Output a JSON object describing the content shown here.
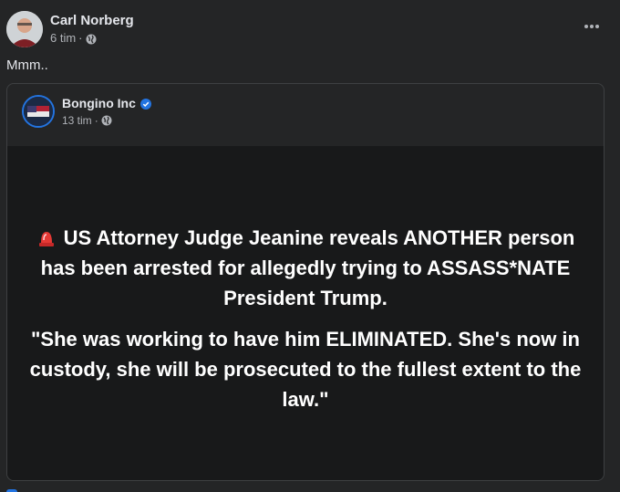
{
  "post": {
    "author": "Carl Norberg",
    "time": "6 tim",
    "separator": "·",
    "privacy_icon": "globe-icon",
    "more_icon": "more-options-icon",
    "caption": "Mmm.."
  },
  "shared": {
    "page_name": "Bongino Inc",
    "verified_icon": "verified-badge-icon",
    "time": "13 tim",
    "separator": "·",
    "privacy_icon": "globe-icon",
    "emoji_icon": "siren-icon",
    "headline": "US Attorney Judge Jeanine reveals ANOTHER person has been arrested for allegedly trying to ASSASS*NATE President Trump.",
    "quote": "\"She was working to have him ELIMINATED. She's now in custody, she will be prosecuted to the fullest extent to the law.\""
  },
  "colors": {
    "background": "#242526",
    "content_background": "#18191a",
    "accent": "#2374e1",
    "secondary_text": "#b0b3b8"
  }
}
